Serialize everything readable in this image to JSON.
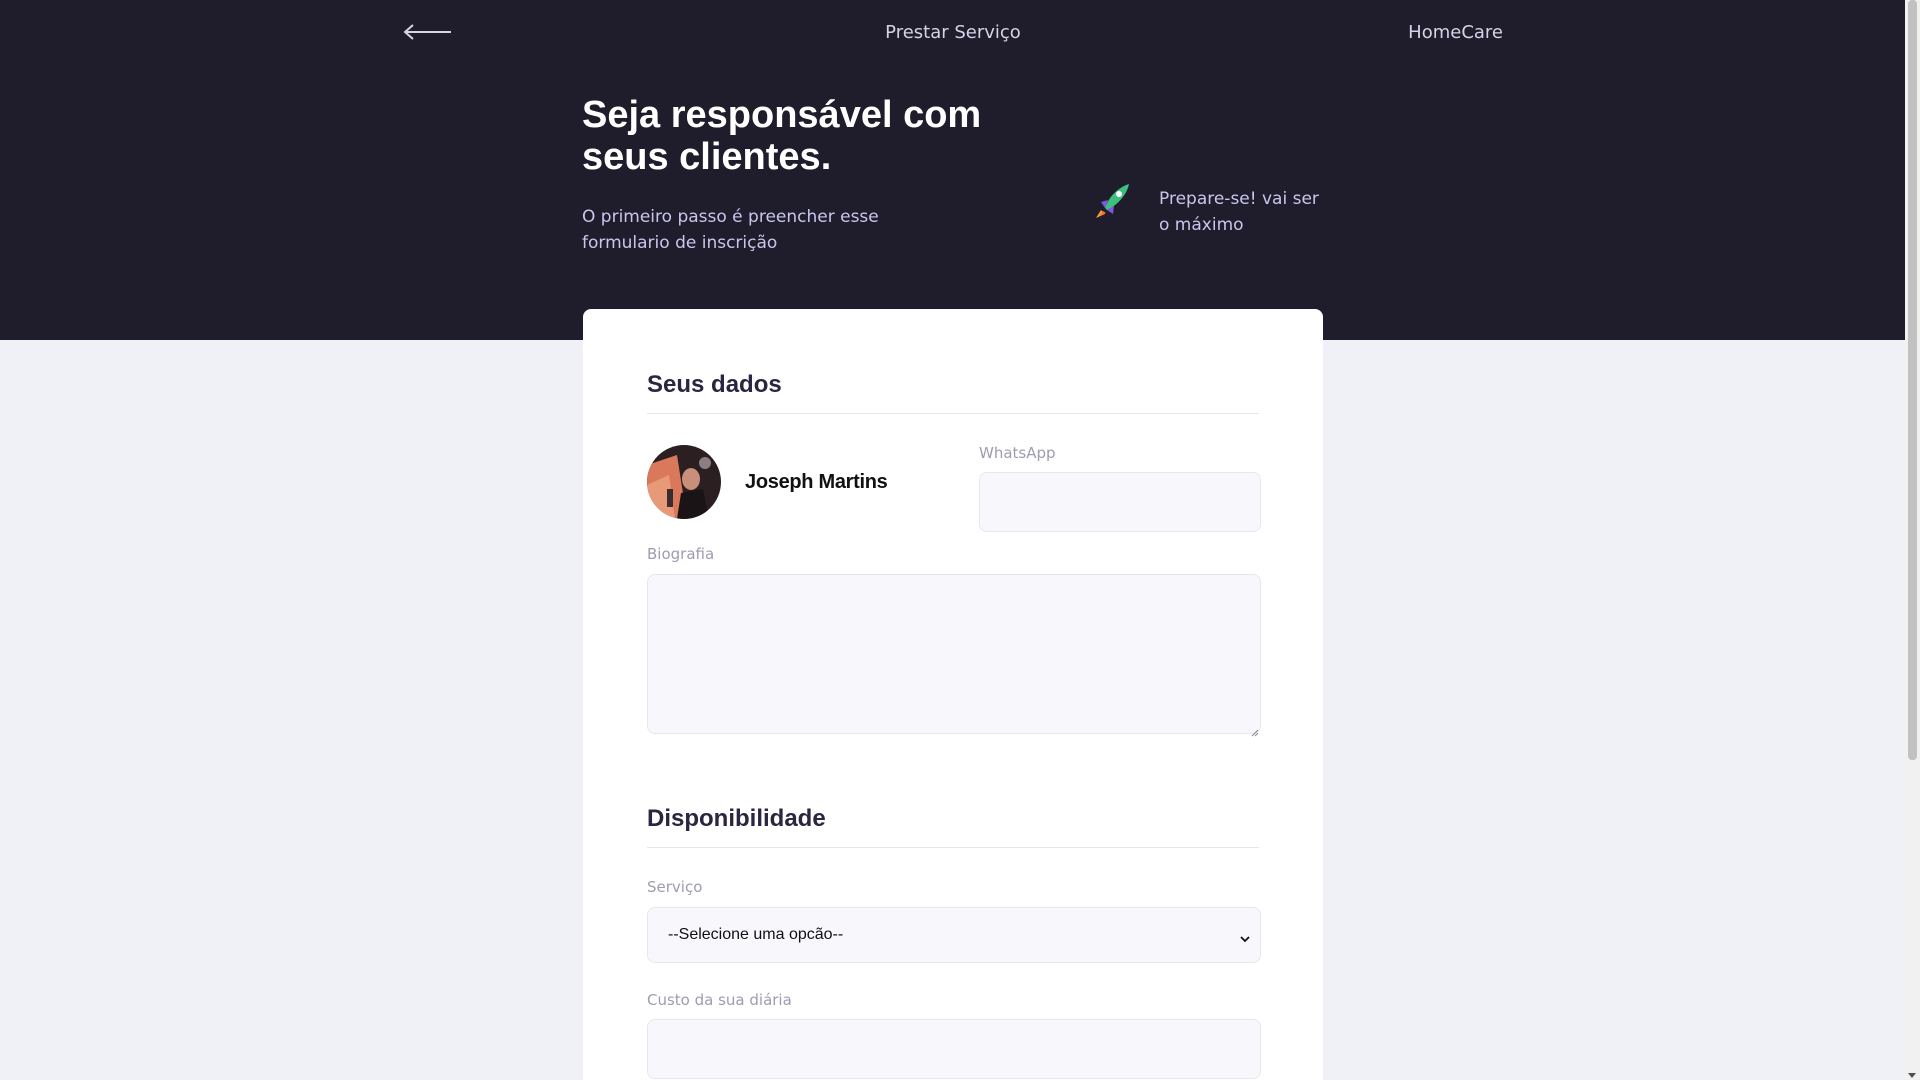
{
  "header": {
    "back_icon": "arrow-left-icon",
    "title": "Prestar Serviço",
    "brand": "HomeCare"
  },
  "hero": {
    "headline": "Seja responsável com seus clientes.",
    "subtitle": "O primeiro passo é preencher esse formulario de inscrição",
    "tagline_icon": "rocket-icon",
    "tagline": "Prepare-se! vai ser o máximo"
  },
  "form": {
    "section_personal": "Seus dados",
    "user_name": "Joseph Martins",
    "whatsapp_label": "WhatsApp",
    "whatsapp_value": "",
    "bio_label": "Biografia",
    "bio_value": "",
    "section_availability": "Disponibilidade",
    "service_label": "Serviço",
    "service_selected": "--Selecione uma opcão--",
    "cost_label": "Custo da sua diária",
    "cost_value": ""
  },
  "colors": {
    "hero_bg": "#1f1d2b",
    "page_bg": "#f0f0f7",
    "accent_text": "#c9c6ee",
    "heading": "#2a2540"
  }
}
